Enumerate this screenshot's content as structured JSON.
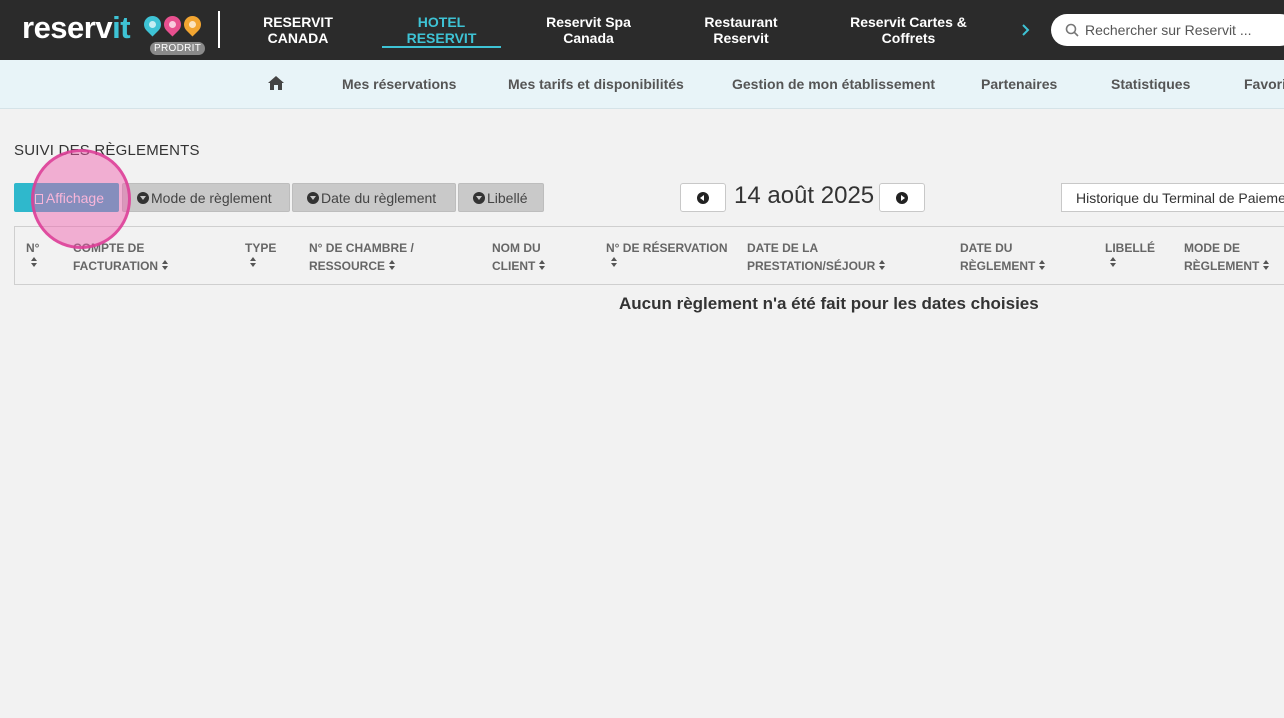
{
  "brand": {
    "name_part1": "reserv",
    "name_part2": "it",
    "badge": "PRODRIT",
    "pin_colors": [
      "#3ec3d5",
      "#e8508f",
      "#f2a531"
    ]
  },
  "topnav": {
    "items": [
      {
        "label": "RESERVIT\nCANADA",
        "active": false
      },
      {
        "label": "HOTEL\nRESERVIT",
        "active": true
      },
      {
        "label": "Reservit Spa\nCanada",
        "active": false
      },
      {
        "label": "Restaurant\nReservit",
        "active": false
      },
      {
        "label": "Reservit Cartes &\nCoffrets",
        "active": false
      }
    ],
    "more_icon": "chevron-right-icon"
  },
  "search": {
    "placeholder": "Rechercher sur Reservit ..."
  },
  "subnav": {
    "home_icon": "home-icon",
    "items": [
      "Mes réservations",
      "Mes tarifs et disponibilités",
      "Gestion de mon établissement",
      "Partenaires",
      "Statistiques",
      "Favoris"
    ]
  },
  "page": {
    "title": "SUIVI DES RÈGLEMENTS"
  },
  "filters": {
    "tabs": [
      {
        "label": "Affichage",
        "icon": "trash-icon",
        "active": true
      },
      {
        "label": "Mode de règlement",
        "icon": "caret-down-icon",
        "active": false
      },
      {
        "label": "Date du règlement",
        "icon": "caret-down-icon",
        "active": false
      },
      {
        "label": "Libellé",
        "icon": "caret-down-icon",
        "active": false
      }
    ],
    "date": "14 août 2025",
    "history_select": "Historique du Terminal de Paiement"
  },
  "table": {
    "columns": [
      "N°",
      "COMPTE DE\nFACTURATION",
      "TYPE",
      "N° DE CHAMBRE /\nRESSOURCE",
      "NOM DU\nCLIENT",
      "N° DE RÉSERVATION",
      "DATE DE LA\nPRESTATION/SÉJOUR",
      "DATE DU\nRÈGLEMENT",
      "LIBELLÉ",
      "MODE DE\nRÈGLEMENT"
    ],
    "empty_message": "Aucun règlement n'a été fait pour les dates choisies"
  },
  "colors": {
    "topbar": "#2b2b2b",
    "accent": "#3ec3d5",
    "subnav_bg": "#e8f4f8",
    "page_bg": "#f2f2f2"
  }
}
